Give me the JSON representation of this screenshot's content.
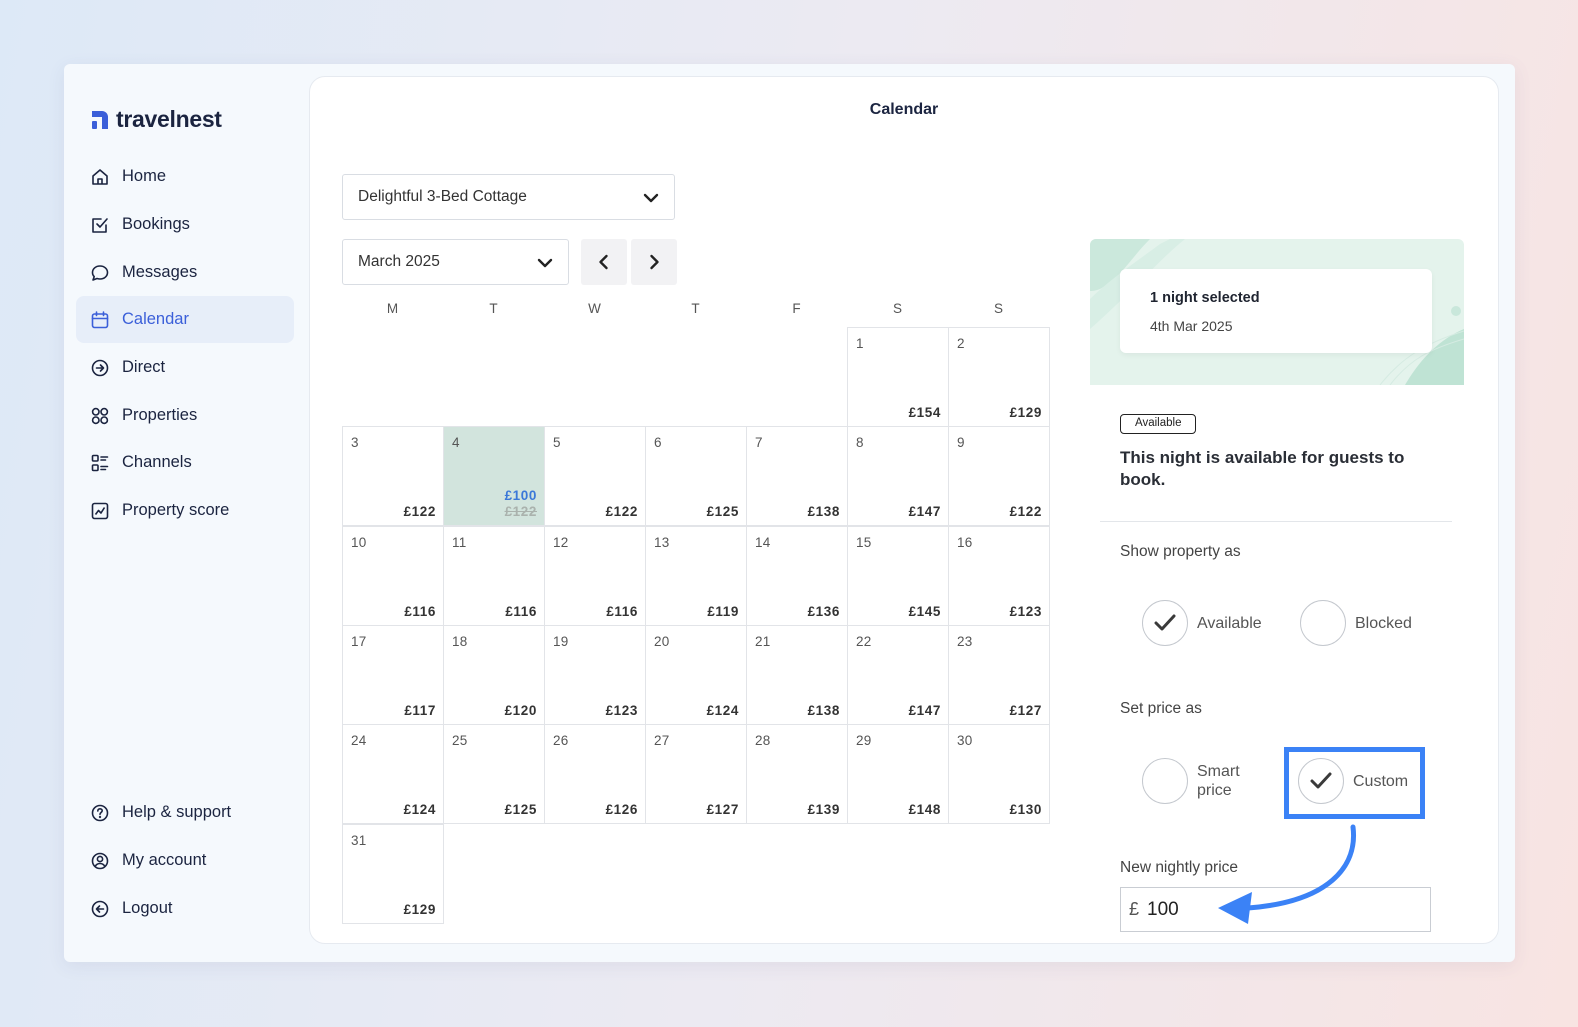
{
  "brand": {
    "name": "travelnest",
    "color": "#3b5fd9"
  },
  "nav": {
    "items": [
      {
        "label": "Home",
        "icon": "home-icon"
      },
      {
        "label": "Bookings",
        "icon": "bookings-icon"
      },
      {
        "label": "Messages",
        "icon": "messages-icon"
      },
      {
        "label": "Calendar",
        "icon": "calendar-icon",
        "active": true
      },
      {
        "label": "Direct",
        "icon": "direct-icon"
      },
      {
        "label": "Properties",
        "icon": "properties-icon"
      },
      {
        "label": "Channels",
        "icon": "channels-icon"
      },
      {
        "label": "Property score",
        "icon": "property-score-icon"
      }
    ],
    "bottom": [
      {
        "label": "Help & support",
        "icon": "help-icon"
      },
      {
        "label": "My account",
        "icon": "account-icon"
      },
      {
        "label": "Logout",
        "icon": "logout-icon"
      }
    ]
  },
  "page": {
    "title": "Calendar"
  },
  "property_select": {
    "value": "Delightful 3-Bed Cottage"
  },
  "month_select": {
    "value": "March 2025"
  },
  "weekdays": [
    "M",
    "T",
    "W",
    "T",
    "F",
    "S",
    "S"
  ],
  "calendar": {
    "first_weekday_index": 5,
    "days": [
      {
        "day": "1",
        "price": "£154"
      },
      {
        "day": "2",
        "price": "£129"
      },
      {
        "day": "3",
        "price": "£122"
      },
      {
        "day": "4",
        "price": "£100",
        "old_price": "£122",
        "selected": true
      },
      {
        "day": "5",
        "price": "£122"
      },
      {
        "day": "6",
        "price": "£125"
      },
      {
        "day": "7",
        "price": "£138"
      },
      {
        "day": "8",
        "price": "£147"
      },
      {
        "day": "9",
        "price": "£122"
      },
      {
        "day": "10",
        "price": "£116"
      },
      {
        "day": "11",
        "price": "£116"
      },
      {
        "day": "12",
        "price": "£116"
      },
      {
        "day": "13",
        "price": "£119"
      },
      {
        "day": "14",
        "price": "£136"
      },
      {
        "day": "15",
        "price": "£145"
      },
      {
        "day": "16",
        "price": "£123"
      },
      {
        "day": "17",
        "price": "£117"
      },
      {
        "day": "18",
        "price": "£120"
      },
      {
        "day": "19",
        "price": "£123"
      },
      {
        "day": "20",
        "price": "£124"
      },
      {
        "day": "21",
        "price": "£138"
      },
      {
        "day": "22",
        "price": "£147"
      },
      {
        "day": "23",
        "price": "£127"
      },
      {
        "day": "24",
        "price": "£124"
      },
      {
        "day": "25",
        "price": "£125"
      },
      {
        "day": "26",
        "price": "£126"
      },
      {
        "day": "27",
        "price": "£127"
      },
      {
        "day": "28",
        "price": "£139"
      },
      {
        "day": "29",
        "price": "£148"
      },
      {
        "day": "30",
        "price": "£130"
      },
      {
        "day": "31",
        "price": "£129"
      }
    ]
  },
  "panel": {
    "nights_selected": "1 night selected",
    "selected_date": "4th Mar 2025",
    "status_badge": "Available",
    "status_text": "This night is available for guests to book.",
    "show_as_label": "Show property as",
    "show_as_options": [
      "Available",
      "Blocked"
    ],
    "show_as_selected": "Available",
    "price_as_label": "Set price as",
    "price_as_options": [
      "Smart price",
      "Custom"
    ],
    "price_as_selected": "Custom",
    "new_price_label": "New nightly price",
    "currency_symbol": "£",
    "new_price_value": "100"
  },
  "colors": {
    "accent": "#3b82f6",
    "selected_day": "#d2e4dd",
    "new_price": "#3b78d8"
  }
}
